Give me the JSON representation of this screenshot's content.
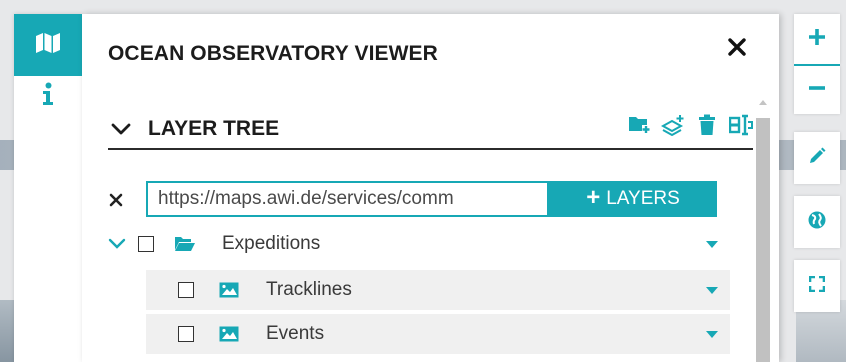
{
  "panel": {
    "title": "OCEAN OBSERVATORY VIEWER"
  },
  "tabs": [
    {
      "icon": "map-icon",
      "active": true
    },
    {
      "icon": "info-icon",
      "active": false
    }
  ],
  "layer_tree": {
    "title": "LAYER TREE",
    "tools": [
      "add-folder-icon",
      "add-layer-icon",
      "trash-icon",
      "layout-icon"
    ],
    "url_input": {
      "value": "https://maps.awi.de/services/comm"
    },
    "add_layers_label": "LAYERS",
    "items": [
      {
        "label": "Expeditions",
        "icon": "folder-open-icon",
        "expanded": true,
        "checked": false
      },
      {
        "label": "Tracklines",
        "icon": "image-icon",
        "checked": false
      },
      {
        "label": "Events",
        "icon": "image-icon",
        "checked": false
      }
    ]
  },
  "map_controls": [
    "zoom-in-icon",
    "zoom-out-icon",
    "pencil-icon",
    "globe-icon",
    "fullscreen-icon"
  ],
  "colors": {
    "accent": "#17a8b5",
    "text": "#1c1c1c"
  }
}
